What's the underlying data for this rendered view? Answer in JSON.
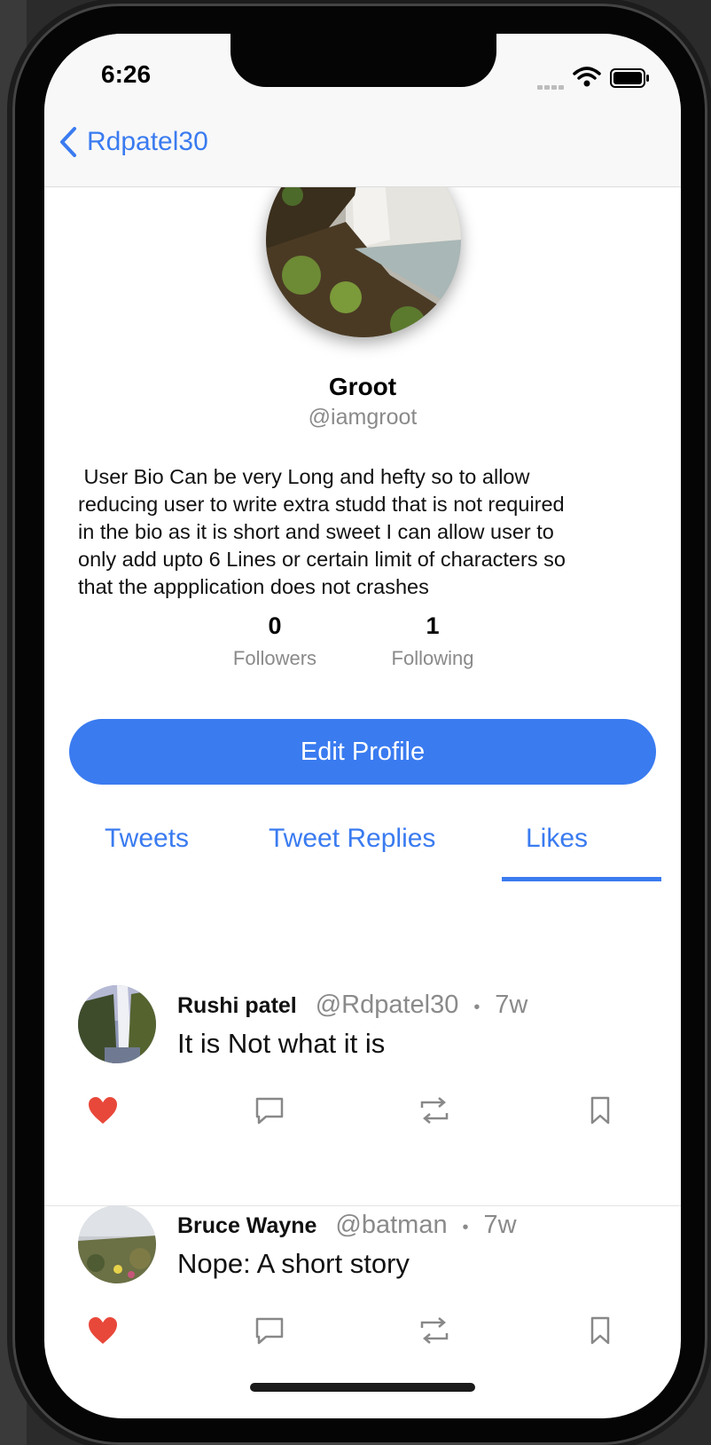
{
  "status_bar": {
    "time": "6:26"
  },
  "nav": {
    "back_label": "Rdpatel30"
  },
  "profile": {
    "name": "Groot",
    "handle": "@iamgroot",
    "bio": " User Bio Can be very Long and hefty so to allow\nreducing user to write extra studd that is not required\nin the bio as it is short and sweet I can allow user to\nonly add upto 6 Lines or certain limit of characters so\nthat the appplication does not crashes",
    "followers_count": "0",
    "followers_label": "Followers",
    "following_count": "1",
    "following_label": "Following",
    "edit_button": "Edit Profile"
  },
  "tabs": {
    "items": [
      {
        "label": "Tweets"
      },
      {
        "label": "Tweet Replies"
      },
      {
        "label": "Likes"
      }
    ],
    "selected": "Likes"
  },
  "tweets": [
    {
      "author": "Rushi patel",
      "handle": "@Rdpatel30",
      "separator": "•",
      "time": "7w",
      "text": "It is Not what it is",
      "liked": true
    },
    {
      "author": "Bruce Wayne",
      "handle": "@batman",
      "separator": "•",
      "time": "7w",
      "text": "Nope: A short story",
      "liked": true
    }
  ],
  "colors": {
    "accent": "#3a7bf0",
    "like": "#e8483a",
    "muted": "#8a8a8a"
  },
  "icons": [
    "back-chevron-icon",
    "wifi-icon",
    "battery-icon",
    "heart-icon",
    "comment-icon",
    "retweet-icon",
    "bookmark-icon"
  ]
}
